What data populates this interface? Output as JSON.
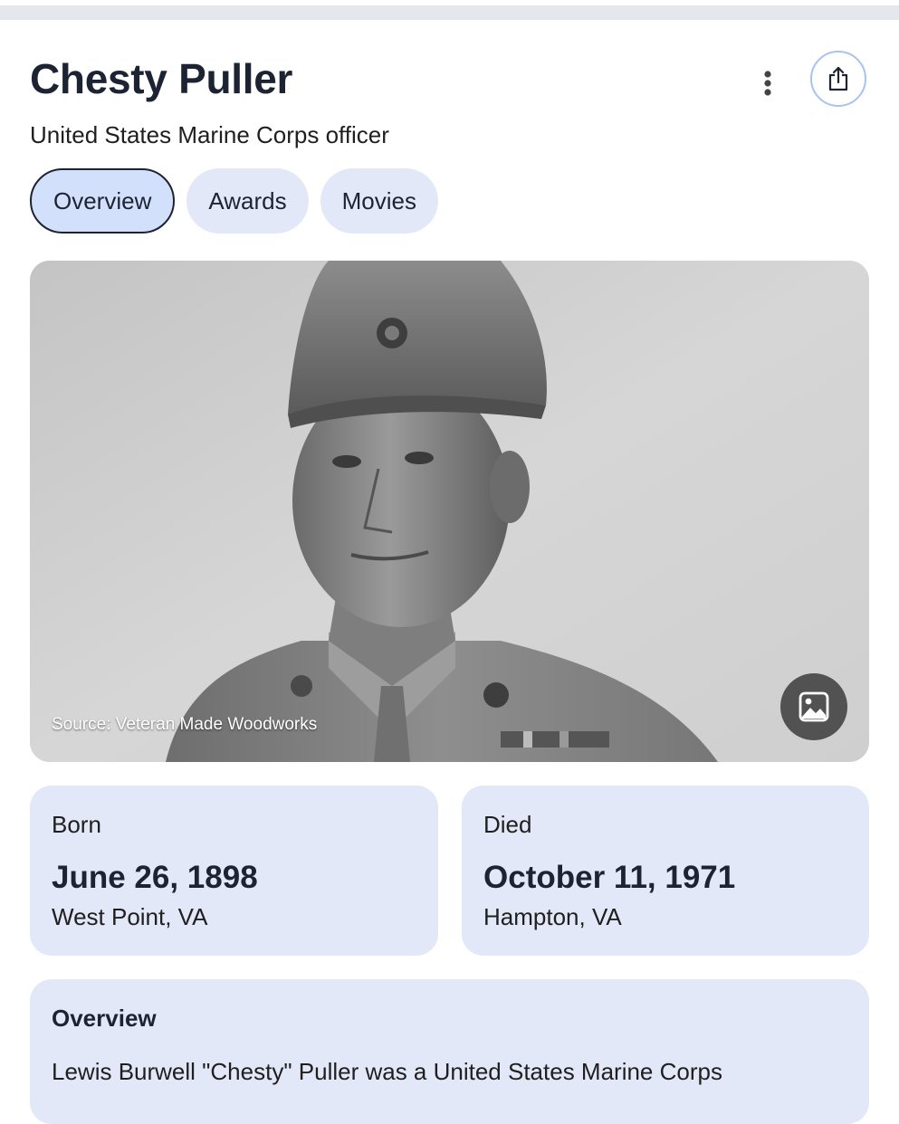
{
  "header": {
    "title": "Chesty Puller",
    "subtitle": "United States Marine Corps officer"
  },
  "actions": {
    "more_icon": "more-vertical-icon",
    "share_icon": "share-icon"
  },
  "tabs": [
    {
      "label": "Overview",
      "active": true
    },
    {
      "label": "Awards",
      "active": false
    },
    {
      "label": "Movies",
      "active": false
    }
  ],
  "hero_image": {
    "source": "Source: Veteran Made Woodworks",
    "button_icon": "image-icon"
  },
  "born": {
    "label": "Born",
    "date": "June 26, 1898",
    "place": "West Point, VA"
  },
  "died": {
    "label": "Died",
    "date": "October 11, 1971",
    "place": "Hampton, VA"
  },
  "overview": {
    "heading": "Overview",
    "text": "Lewis Burwell \"Chesty\" Puller was a United States Marine Corps"
  },
  "colors": {
    "chip_bg": "#e3e8f8",
    "chip_active_bg": "#d3e0fb",
    "title": "#1c2433",
    "share_ring": "#a8c3ec"
  }
}
